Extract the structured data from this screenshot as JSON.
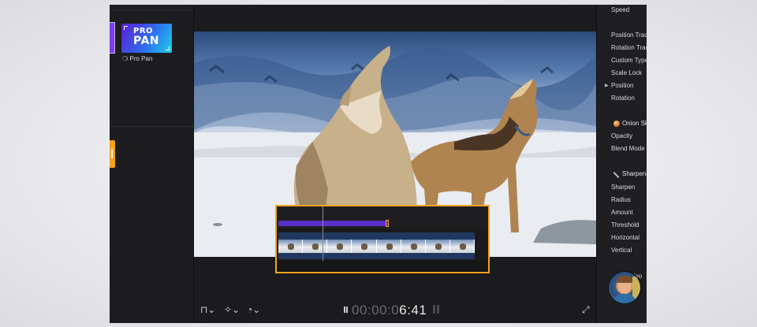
{
  "left_panel": {
    "plugin_thumbnail": {
      "line1": "PRO",
      "line2": "PAN"
    },
    "plugin_label": "❍ Pro Pan"
  },
  "viewer": {
    "timecode_dim": "00:00:0",
    "timecode_bright": "6:41",
    "controls": {
      "transform_icon": "crop-transform-icon",
      "enhance_icon": "magic-wand-icon",
      "speed_icon": "speedometer-icon",
      "fullscreen_icon": "expand-arrows-icon"
    }
  },
  "inspector": {
    "items": {
      "speed": "Speed",
      "position_track": "Position Trac",
      "rotation_track": "Rotation Trac",
      "custom_type": "Custom Type",
      "scale_lock": "Scale Lock",
      "position": "Position",
      "rotation": "Rotation",
      "onion_skin": "Onion Sk",
      "opacity": "Opacity",
      "blend_mode": "Blend Mode",
      "sharpen_header": "Sharpeni",
      "sharpen": "Sharpen",
      "radius": "Radius",
      "amount": "Amount",
      "threshold": "Threshold",
      "horizontal": "Horizontal",
      "vertical": "Vertical",
      "video_partial": "ideo"
    }
  },
  "colors": {
    "accent_orange": "#f2a41e",
    "accent_purple": "#5a2fc8",
    "panel_bg": "#1b1b1d"
  }
}
